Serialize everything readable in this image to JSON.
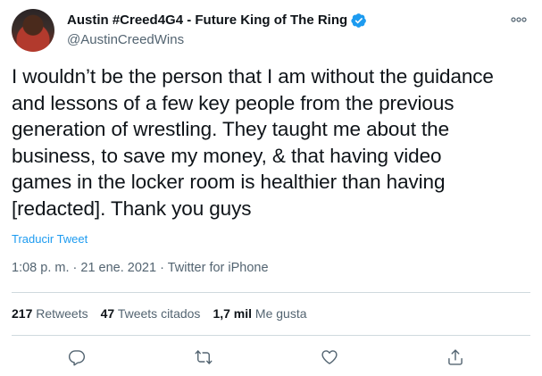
{
  "author": {
    "display_name": "Austin #Creed4G4 - Future King of The Ring",
    "handle": "@AustinCreedWins",
    "verified": true
  },
  "tweet": {
    "lines": [
      "I wouldn’t be the person that I am without the guidance",
      "and lessons of a few key people from the previous",
      "generation of wrestling. They taught me about the",
      "business, to save my money, & that having video",
      "games in the locker room is healthier than having",
      "[redacted]. Thank you guys"
    ],
    "translate_label": "Traducir Tweet",
    "time": "1:08 p. m.",
    "date": "21 ene. 2021",
    "source": "Twitter for iPhone",
    "separator": "·"
  },
  "stats": {
    "retweets_count": "217",
    "retweets_label": "Retweets",
    "quotes_count": "47",
    "quotes_label": "Tweets citados",
    "likes_count": "1,7 mil",
    "likes_label": "Me gusta"
  },
  "icons": {
    "verified": "verified-badge-icon",
    "more": "more-icon",
    "reply": "reply-icon",
    "retweet": "retweet-icon",
    "like": "like-icon",
    "share": "share-icon"
  },
  "colors": {
    "accent": "#1d9bf0",
    "text": "#0f1419",
    "secondary": "#536471",
    "divider": "#cfd9de"
  }
}
